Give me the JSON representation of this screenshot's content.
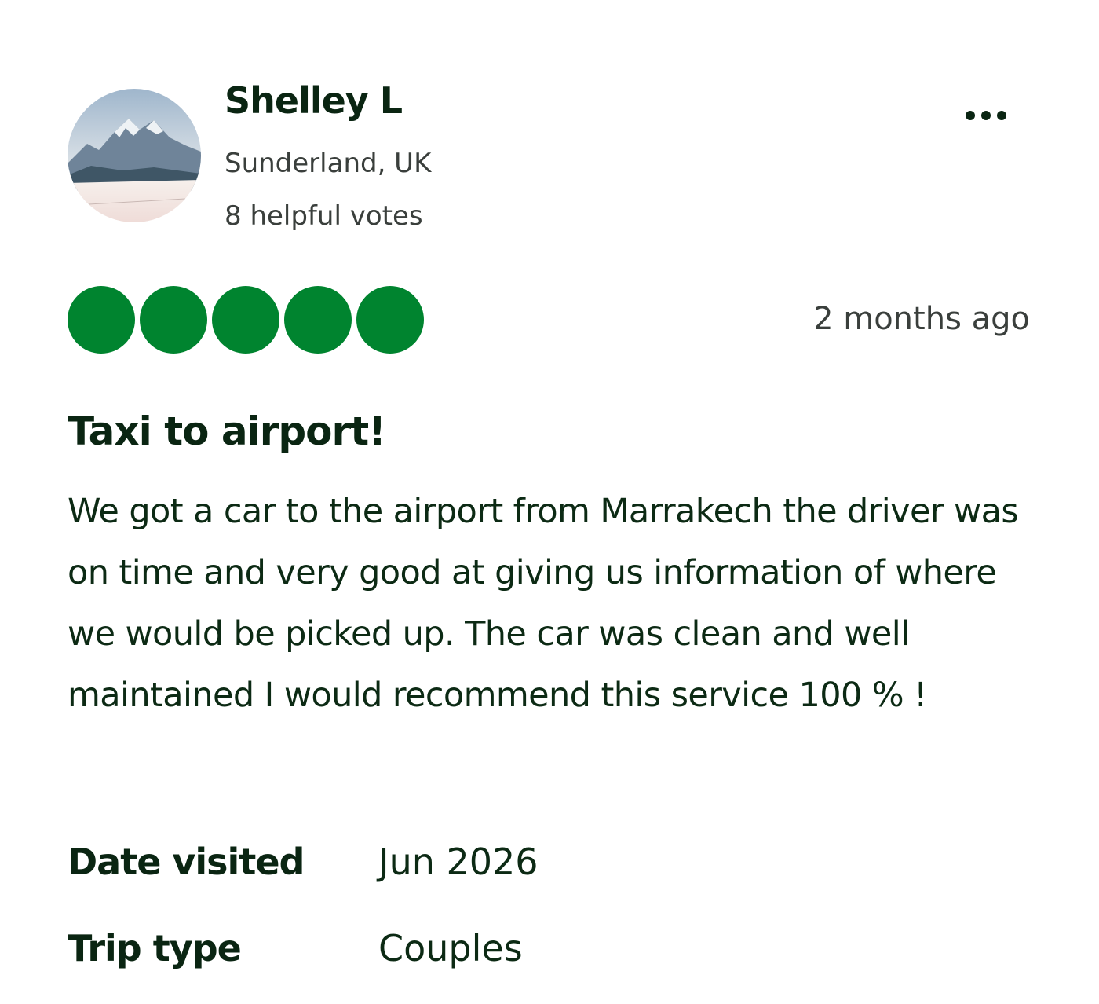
{
  "reviewer": {
    "name": "Shelley L",
    "location": "Sunderland, UK",
    "helpful_votes": "8 helpful votes",
    "avatar_icon": "mountain-landscape-photo"
  },
  "menu": {
    "icon": "more-options-icon"
  },
  "rating": {
    "value": 5,
    "max": 5,
    "bubble_color": "#00842f"
  },
  "review": {
    "date": "2 months ago",
    "title": "Taxi to airport!",
    "body": "We got a car to the airport from Marrakech the driver was on time and very good at giving us information of where we would be picked up. The car was clean and well maintained I would recommend this service 100 % !"
  },
  "details": [
    {
      "label": "Date visited",
      "value": "Jun 2026"
    },
    {
      "label": "Trip type",
      "value": "Couples"
    }
  ],
  "colors": {
    "text_dark": "#0a2512",
    "text_muted": "#3a3f3c",
    "accent_green": "#00842f"
  }
}
